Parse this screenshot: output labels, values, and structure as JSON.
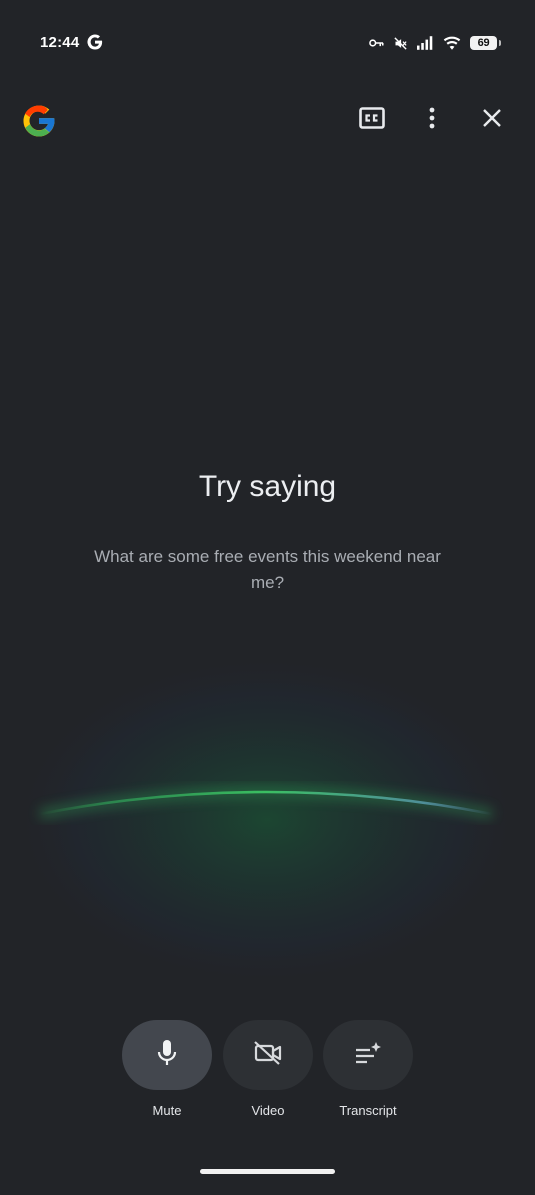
{
  "status_bar": {
    "time": "12:44",
    "battery_level": "69",
    "icons": [
      "google-g-icon",
      "vpn-key-icon",
      "mute-icon",
      "signal-icon",
      "wifi-icon",
      "battery-icon"
    ]
  },
  "top_bar": {
    "logo": "google-logo-icon",
    "actions": [
      "closed-captions-icon",
      "more-vertical-icon",
      "close-icon"
    ]
  },
  "prompt": {
    "title": "Try saying",
    "suggestion": "What are some free events this weekend near me?"
  },
  "controls": {
    "mute_label": "Mute",
    "video_label": "Video",
    "transcript_label": "Transcript"
  },
  "colors": {
    "background": "#222428",
    "glow_accent": "#34a853",
    "button_active": "#43474e",
    "button_inactive": "#2d3034"
  }
}
